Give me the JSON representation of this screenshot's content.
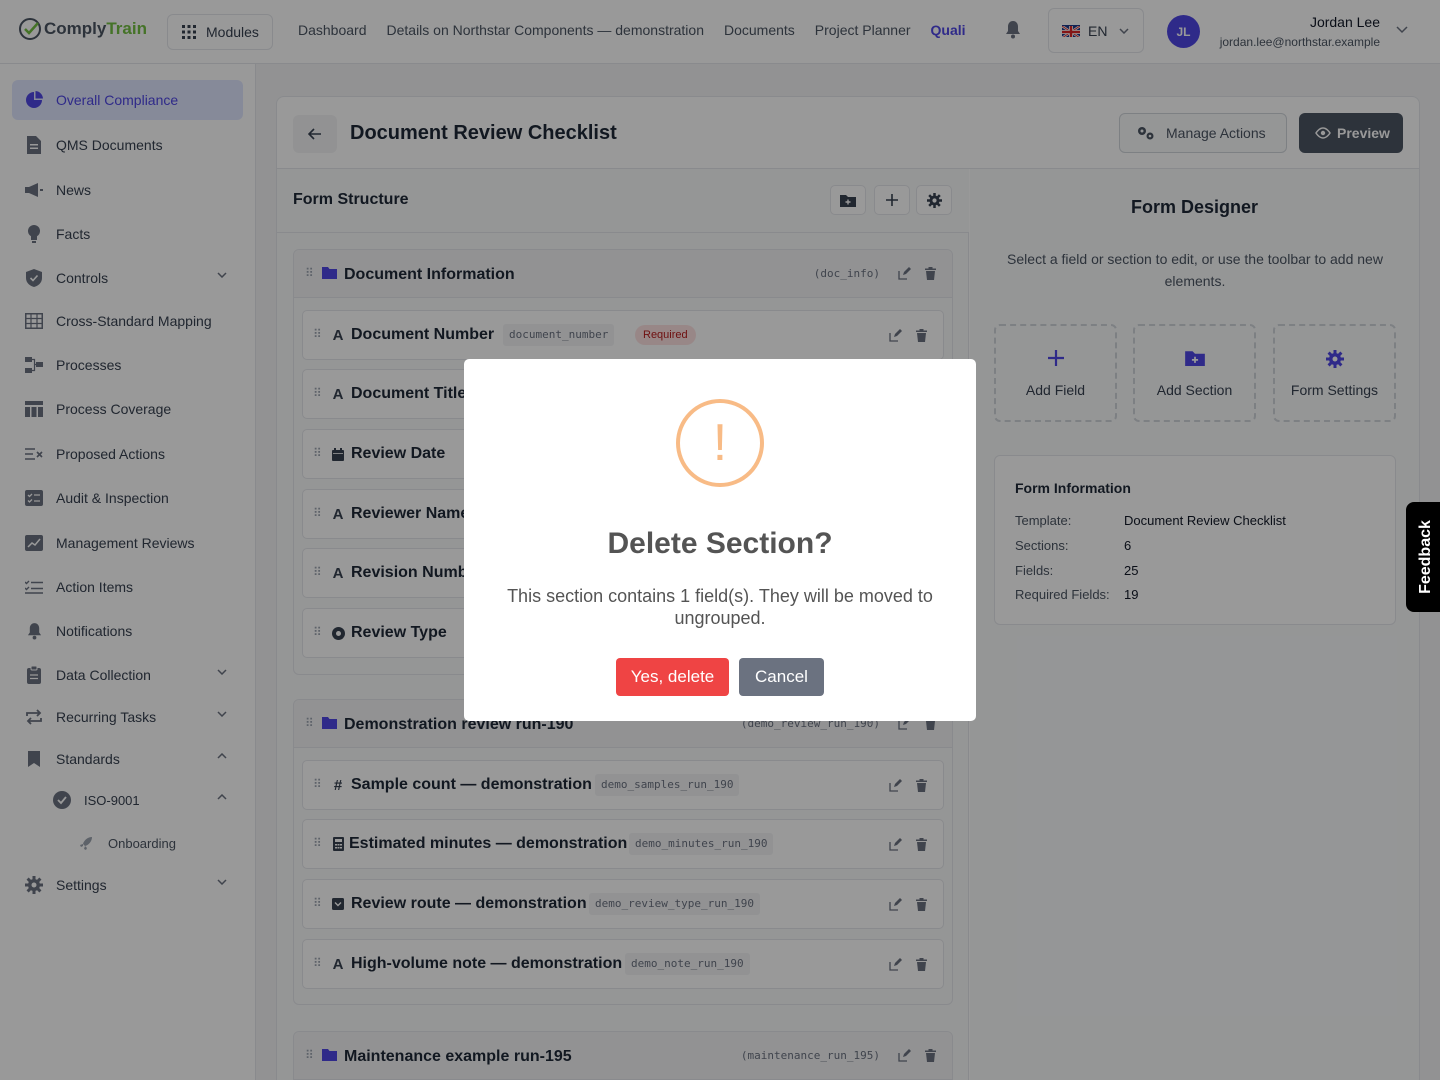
{
  "app": {
    "logo_a": "Comply",
    "logo_b": "Train"
  },
  "topbar": {
    "modules_label": "Modules",
    "nav": [
      "Dashboard",
      "Details on Northstar Components — demonstration",
      "Documents",
      "Project Planner",
      "Quali"
    ],
    "language": "EN",
    "user": {
      "initials": "JL",
      "name": "Jordan Lee",
      "email": "jordan.lee@northstar.example"
    }
  },
  "sidebar": {
    "items": [
      "Overall Compliance",
      "QMS Documents",
      "News",
      "Facts",
      "Controls",
      "Cross-Standard Mapping",
      "Processes",
      "Process Coverage",
      "Proposed Actions",
      "Audit & Inspection",
      "Management Reviews",
      "Action Items",
      "Notifications",
      "Data Collection",
      "Recurring Tasks",
      "Standards",
      "ISO-9001",
      "Onboarding",
      "Settings"
    ]
  },
  "page": {
    "title": "Document Review Checklist",
    "manage_actions": "Manage Actions",
    "preview": "Preview"
  },
  "structure": {
    "title": "Form Structure",
    "sections": [
      {
        "name": "Document Information",
        "key": "(doc_info)",
        "fields": [
          {
            "label": "Document Number",
            "key": "document_number",
            "required": "Required"
          },
          {
            "label": "Document Title"
          },
          {
            "label": "Review Date"
          },
          {
            "label": "Reviewer Name"
          },
          {
            "label": "Revision Number"
          },
          {
            "label": "Review Type"
          }
        ]
      },
      {
        "name": "Demonstration review run-190",
        "key": "(demo_review_run_190)",
        "fields": [
          {
            "label": "Sample count — demonstration",
            "key": "demo_samples_run_190"
          },
          {
            "label": "Estimated minutes — demonstration",
            "key": "demo_minutes_run_190"
          },
          {
            "label": "Review route — demonstration",
            "key": "demo_review_type_run_190"
          },
          {
            "label": "High-volume note — demonstration",
            "key": "demo_note_run_190"
          }
        ]
      },
      {
        "name": "Maintenance example run-195",
        "key": "(maintenance_run_195)"
      }
    ]
  },
  "designer": {
    "title": "Form Designer",
    "description": "Select a field or section to edit, or use the toolbar to add new elements.",
    "cards": [
      "Add Field",
      "Add Section",
      "Form Settings"
    ],
    "info": {
      "title": "Form Information",
      "rows": [
        {
          "label": "Template:",
          "value": "Document Review Checklist"
        },
        {
          "label": "Sections:",
          "value": "6"
        },
        {
          "label": "Fields:",
          "value": "25"
        },
        {
          "label": "Required Fields:",
          "value": "19"
        }
      ]
    }
  },
  "feedback": "Feedback",
  "modal": {
    "icon": "!",
    "title": "Delete Section?",
    "text": "This section contains 1 field(s). They will be moved to ungrouped.",
    "confirm": "Yes, delete",
    "cancel": "Cancel"
  },
  "colors": {
    "accent": "#4f46e5",
    "danger": "#ef4444",
    "warning": "#f8bb86",
    "brand_green": "#74c044"
  }
}
